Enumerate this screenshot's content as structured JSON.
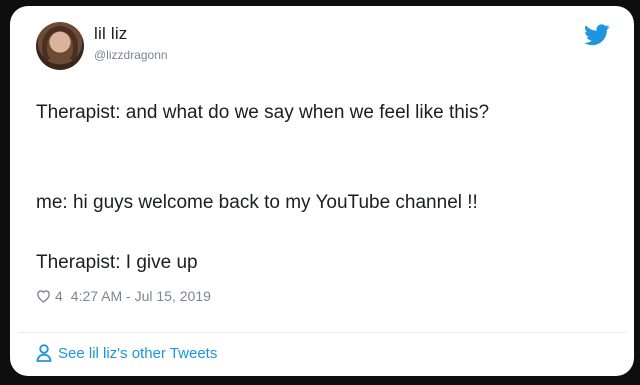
{
  "tweet": {
    "author": {
      "display_name": "lil liz",
      "handle": "@lizzdragonn"
    },
    "lines": [
      "Therapist: and what do we say when we feel like this?",
      "me: hi guys welcome back to my YouTube channel !!",
      "Therapist: I give up"
    ],
    "likes": "4",
    "timestamp": "4:27 AM - Jul 15, 2019",
    "footer_link": "See lil liz's other Tweets",
    "accent_color": "#1b95e0"
  },
  "icons": {
    "brand": "twitter-bird-icon",
    "like": "heart-icon",
    "profile": "person-icon"
  }
}
